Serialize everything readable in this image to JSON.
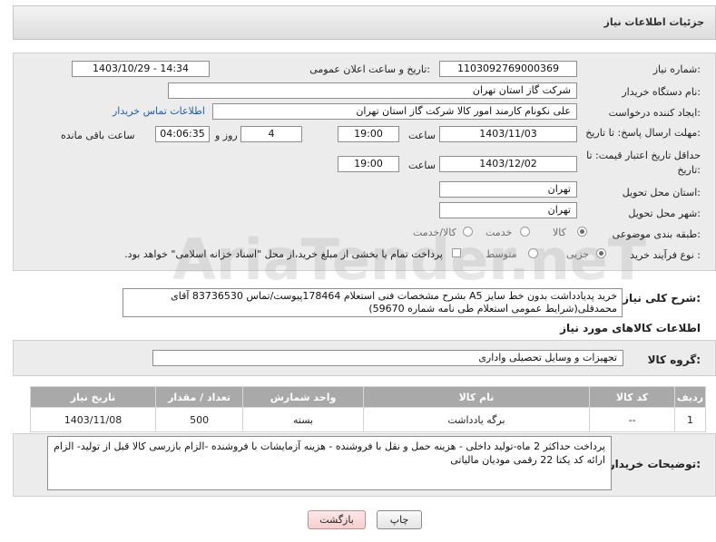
{
  "header": {
    "title": "جزئیات اطلاعات نیاز"
  },
  "fields": {
    "need_number_label": "شماره نیاز:",
    "need_number": "1103092769000369",
    "announce_label": "تاریخ و ساعت اعلان عمومی:",
    "announce_value": "1403/10/29 - 14:34",
    "buyer_org_label": "نام دستگاه خریدار:",
    "buyer_org": "شرکت گاز استان تهران",
    "requester_label": "ایجاد کننده درخواست:",
    "requester": "علی نکونام کارمند امور کالا شرکت گاز استان تهران",
    "contact_link": "اطلاعات تماس خریدار",
    "deadline_label": "مهلت ارسال پاسخ: تا تاریخ:",
    "deadline_date": "1403/11/03",
    "time_label": "ساعت",
    "deadline_time": "19:00",
    "days_value": "4",
    "days_label": "روز و",
    "remaining_time": "04:06:35",
    "remaining_label": "ساعت باقی مانده",
    "validity_label": "حداقل تاریخ اعتبار قیمت: تا تاریخ:",
    "validity_date": "1403/12/02",
    "validity_time": "19:00",
    "province_label": "استان محل تحویل:",
    "province": "تهران",
    "city_label": "شهر محل تحویل:",
    "city": "تهران",
    "category_label": "طبقه بندی موضوعی:",
    "category_options": [
      "کالا",
      "خدمت",
      "کالا/خدمت"
    ],
    "category_selected": "کالا",
    "process_label": "نوع فرآیند خرید :",
    "process_options": [
      "جزیی",
      "متوسط"
    ],
    "process_selected": "جزیی",
    "treasury_note": "پرداخت تمام یا بخشی از مبلغ خرید،از محل \"اسناد خزانه اسلامی\" خواهد بود.",
    "description_label": "شرح کلی نیاز:",
    "description": "خرید پدیادداشت بدون خط سایز A5 بشرح مشخصات فنی استعلام 178464پیوست/تماس 83736530 آقای محمدقلی(شرایط عمومی استعلام طی نامه شماره 59670)",
    "goods_info_title": "اطلاعات کالاهای مورد نیاز",
    "goods_group_label": "گروه کالا:",
    "goods_group": "تجهیزات و وسایل تحصیلی واداری",
    "buyer_notes_label": "توضیحات خریدار:",
    "buyer_notes": "پرداخت حداکثر 2 ماه-تولید داخلی - هزینه حمل و نقل با فروشنده - هزینه آزمایشات با فروشنده -الزام بازرسی کالا قبل از تولید- الزام ارائه کد یکتا 22 رقمی مودیان مالیاتی"
  },
  "table": {
    "headers": [
      "ردیف",
      "کد کالا",
      "نام کالا",
      "واحد شمارش",
      "تعداد / مقدار",
      "تاریخ نیاز"
    ],
    "rows": [
      [
        "1",
        "--",
        "برگه یادداشت",
        "بسته",
        "500",
        "1403/11/08"
      ]
    ]
  },
  "buttons": {
    "print": "چاپ",
    "back": "بازگشت"
  },
  "watermark": "AriaTender.neT"
}
